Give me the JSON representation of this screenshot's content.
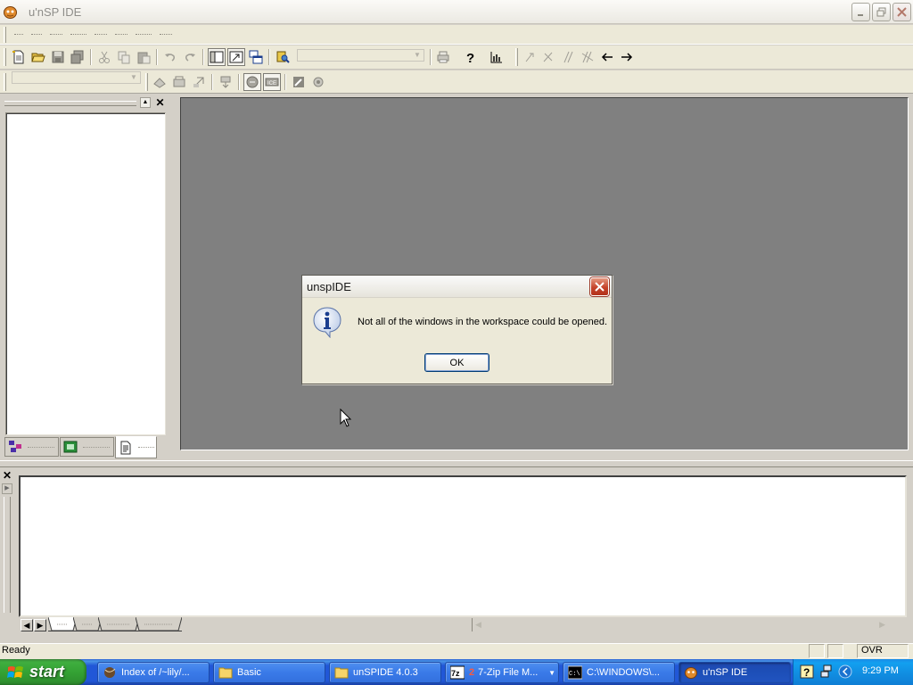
{
  "window": {
    "title": "u'nSP IDE"
  },
  "status": {
    "left": "Ready",
    "ovr": "OVR"
  },
  "dialog": {
    "title": "unspIDE",
    "message": "Not all of the windows in the workspace could be opened.",
    "ok_label": "OK"
  },
  "taskbar": {
    "start_label": "start",
    "tasks": [
      {
        "label": "Index of /~lily/..."
      },
      {
        "label": "Basic"
      },
      {
        "label": "unSPIDE 4.0.3"
      },
      {
        "label": "7-Zip File M..."
      },
      {
        "label": "C:\\WINDOWS\\..."
      },
      {
        "label": "u'nSP IDE"
      }
    ],
    "seven_zip_count": "2",
    "clock": "9:29 PM"
  },
  "colors": {
    "mdi_background": "#808080",
    "taskbar_blue": "#2157d7",
    "start_green": "#34a234",
    "dialog_close_red": "#c5432b"
  }
}
